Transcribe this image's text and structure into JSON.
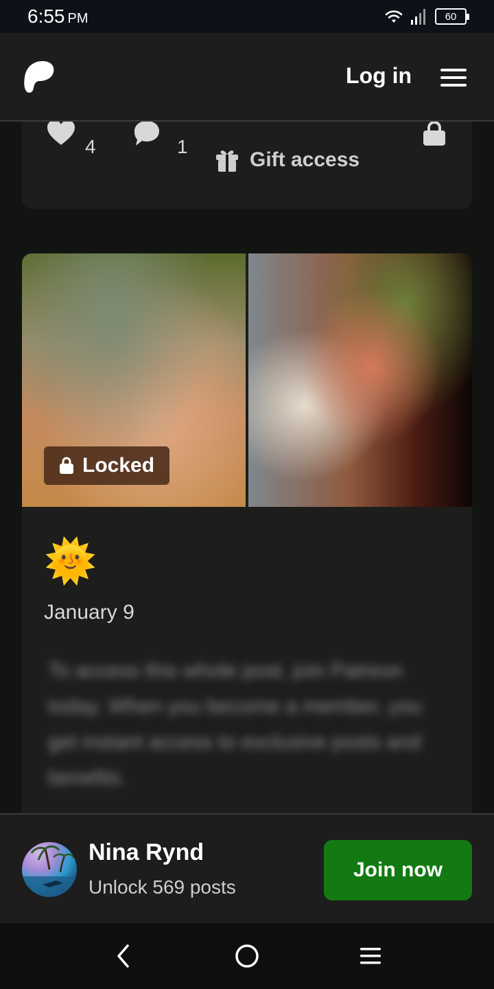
{
  "status_bar": {
    "time": "6:55",
    "ampm": "PM",
    "battery_level": "60",
    "icons": [
      "wifi-icon",
      "signal-icon",
      "battery-icon"
    ]
  },
  "header": {
    "logo_icon": "patreon-logo-icon",
    "login_label": "Log in",
    "menu_icon": "hamburger-menu-icon"
  },
  "previous_post": {
    "likes_count": "4",
    "comments_count": "1",
    "gift_label": "Gift access",
    "icons": [
      "heart-icon",
      "comment-icon",
      "gift-icon",
      "lock-icon"
    ]
  },
  "post": {
    "locked_label": "Locked",
    "emoji": "🌞",
    "date": "January 9",
    "teaser": "To access this whole post, join Patreon today. When you become a member, you get instant access to exclusive posts and benefits."
  },
  "creator_bar": {
    "name": "Nina Rynd",
    "subtitle": "Unlock 569 posts",
    "join_label": "Join now"
  },
  "nav_bar": {
    "icons": [
      "back-icon",
      "home-icon",
      "recents-icon"
    ]
  },
  "colors": {
    "accent_green": "#137a13",
    "card_bg": "#1d1e1c",
    "page_bg": "#121412",
    "header_bg": "#1d1d1d"
  }
}
